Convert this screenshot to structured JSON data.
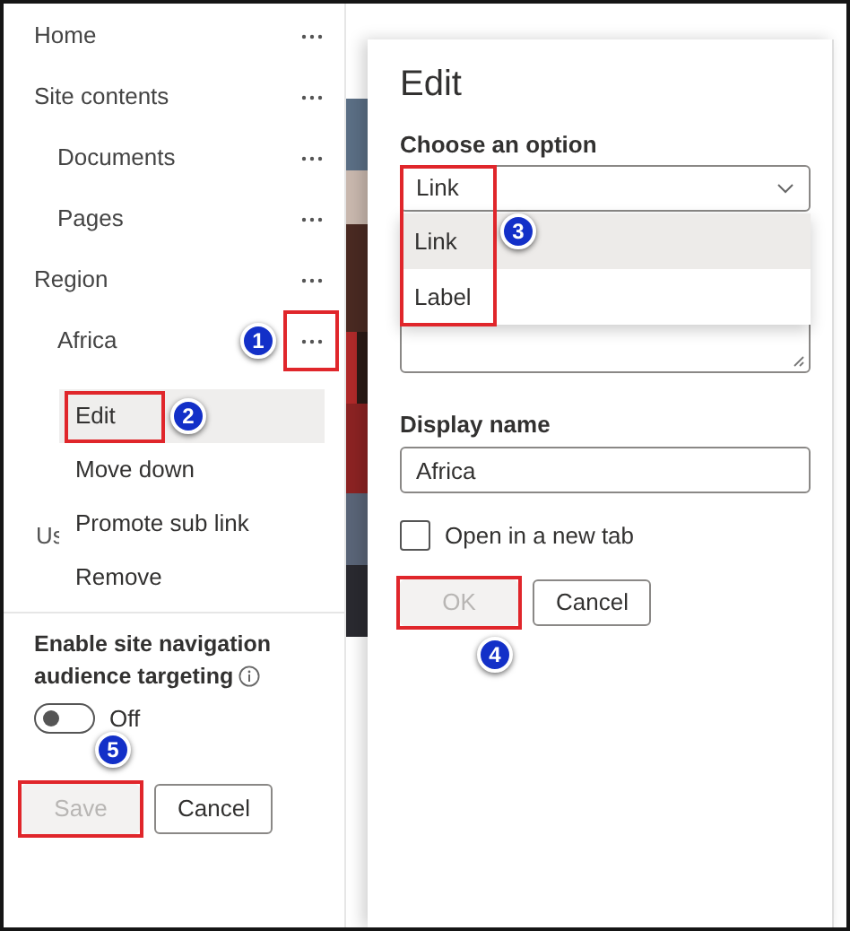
{
  "nav": {
    "items": [
      {
        "label": "Home",
        "indent": false,
        "highlighted": false
      },
      {
        "label": "Site contents",
        "indent": false,
        "highlighted": false
      },
      {
        "label": "Documents",
        "indent": true,
        "highlighted": false
      },
      {
        "label": "Pages",
        "indent": true,
        "highlighted": false
      },
      {
        "label": "Region",
        "indent": false,
        "highlighted": false
      },
      {
        "label": "Africa",
        "indent": true,
        "highlighted": true,
        "callout": "1"
      }
    ],
    "partial_item": "Us"
  },
  "context_menu": {
    "items": [
      {
        "label": "Edit",
        "selected": true,
        "highlighted": true,
        "callout": "2"
      },
      {
        "label": "Move down",
        "selected": false,
        "highlighted": false
      },
      {
        "label": "Promote sub link",
        "selected": false,
        "highlighted": false
      },
      {
        "label": "Remove",
        "selected": false,
        "highlighted": false
      }
    ]
  },
  "audience": {
    "label": "Enable site navigation audience targeting",
    "toggle": {
      "on": false,
      "label": "Off"
    }
  },
  "footer_buttons": [
    {
      "label": "Save",
      "disabled": true,
      "highlighted": true,
      "callout": "5"
    },
    {
      "label": "Cancel",
      "disabled": false,
      "highlighted": false
    }
  ],
  "dialog": {
    "title": "Edit",
    "option_label": "Choose an option",
    "dropdown": {
      "value": "Link",
      "expanded": true,
      "highlighted": true,
      "callout": "3",
      "options": [
        {
          "label": "Link",
          "selected": true
        },
        {
          "label": "Label",
          "selected": false
        }
      ]
    },
    "display_name": {
      "label": "Display name",
      "value": "Africa"
    },
    "new_tab": {
      "label": "Open in a new tab",
      "checked": false
    },
    "buttons": [
      {
        "label": "OK",
        "disabled": true,
        "highlighted": true,
        "callout": "4"
      },
      {
        "label": "Cancel",
        "disabled": false,
        "highlighted": false
      }
    ]
  }
}
